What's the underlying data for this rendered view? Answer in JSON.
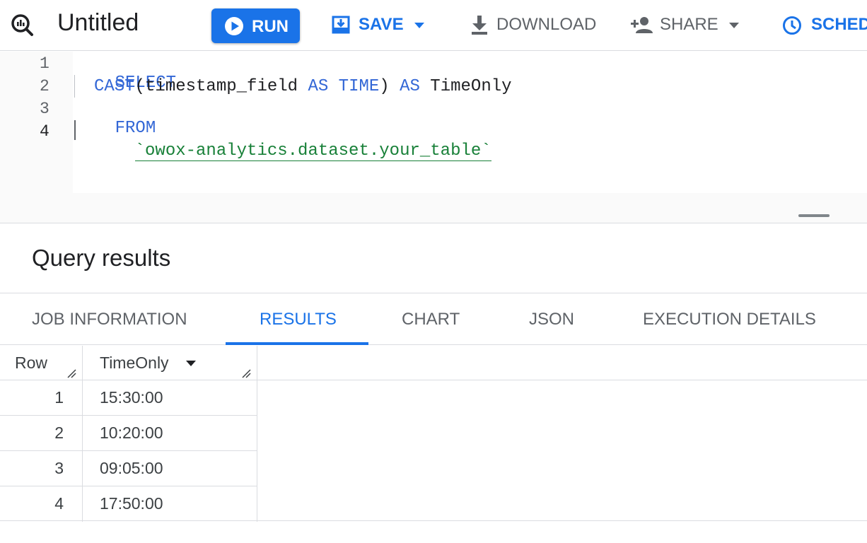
{
  "toolbar": {
    "title": "Untitled",
    "run_label": "RUN",
    "save_label": "SAVE",
    "download_label": "DOWNLOAD",
    "share_label": "SHARE",
    "schedule_label": "SCHED",
    "icons": [
      "query-icon",
      "play-icon",
      "save-icon",
      "dropdown-icon",
      "download-icon",
      "person-add-icon",
      "clock-icon"
    ]
  },
  "editor": {
    "lines": [
      {
        "number": "1",
        "tokens": [
          {
            "text": "SELECT",
            "kind": "keyword"
          }
        ]
      },
      {
        "number": "2",
        "tokens": [
          {
            "text": "CAST",
            "kind": "keyword"
          },
          {
            "text": "(timestamp_field ",
            "kind": "plain"
          },
          {
            "text": "AS TIME",
            "kind": "keyword"
          },
          {
            "text": ") ",
            "kind": "plain"
          },
          {
            "text": "AS",
            "kind": "keyword"
          },
          {
            "text": " TimeOnly",
            "kind": "plain"
          }
        ]
      },
      {
        "number": "3",
        "tokens": [
          {
            "text": "FROM",
            "kind": "keyword"
          }
        ]
      },
      {
        "number": "4",
        "tokens": [
          {
            "text": "`owox-analytics.dataset.your_table`",
            "kind": "table"
          }
        ]
      }
    ],
    "colors": {
      "keyword": "#3367d6",
      "table": "#188038"
    }
  },
  "results": {
    "title": "Query results",
    "tabs": [
      "JOB INFORMATION",
      "RESULTS",
      "CHART",
      "JSON",
      "EXECUTION DETAILS"
    ],
    "active_tab": "RESULTS",
    "columns": [
      "Row",
      "TimeOnly"
    ],
    "rows": [
      {
        "row": "1",
        "time_only": "15:30:00"
      },
      {
        "row": "2",
        "time_only": "10:20:00"
      },
      {
        "row": "3",
        "time_only": "09:05:00"
      },
      {
        "row": "4",
        "time_only": "17:50:00"
      }
    ]
  },
  "theme": {
    "accent": "#1a73e8",
    "border": "#dadce0",
    "muted_text": "#5f6368"
  }
}
